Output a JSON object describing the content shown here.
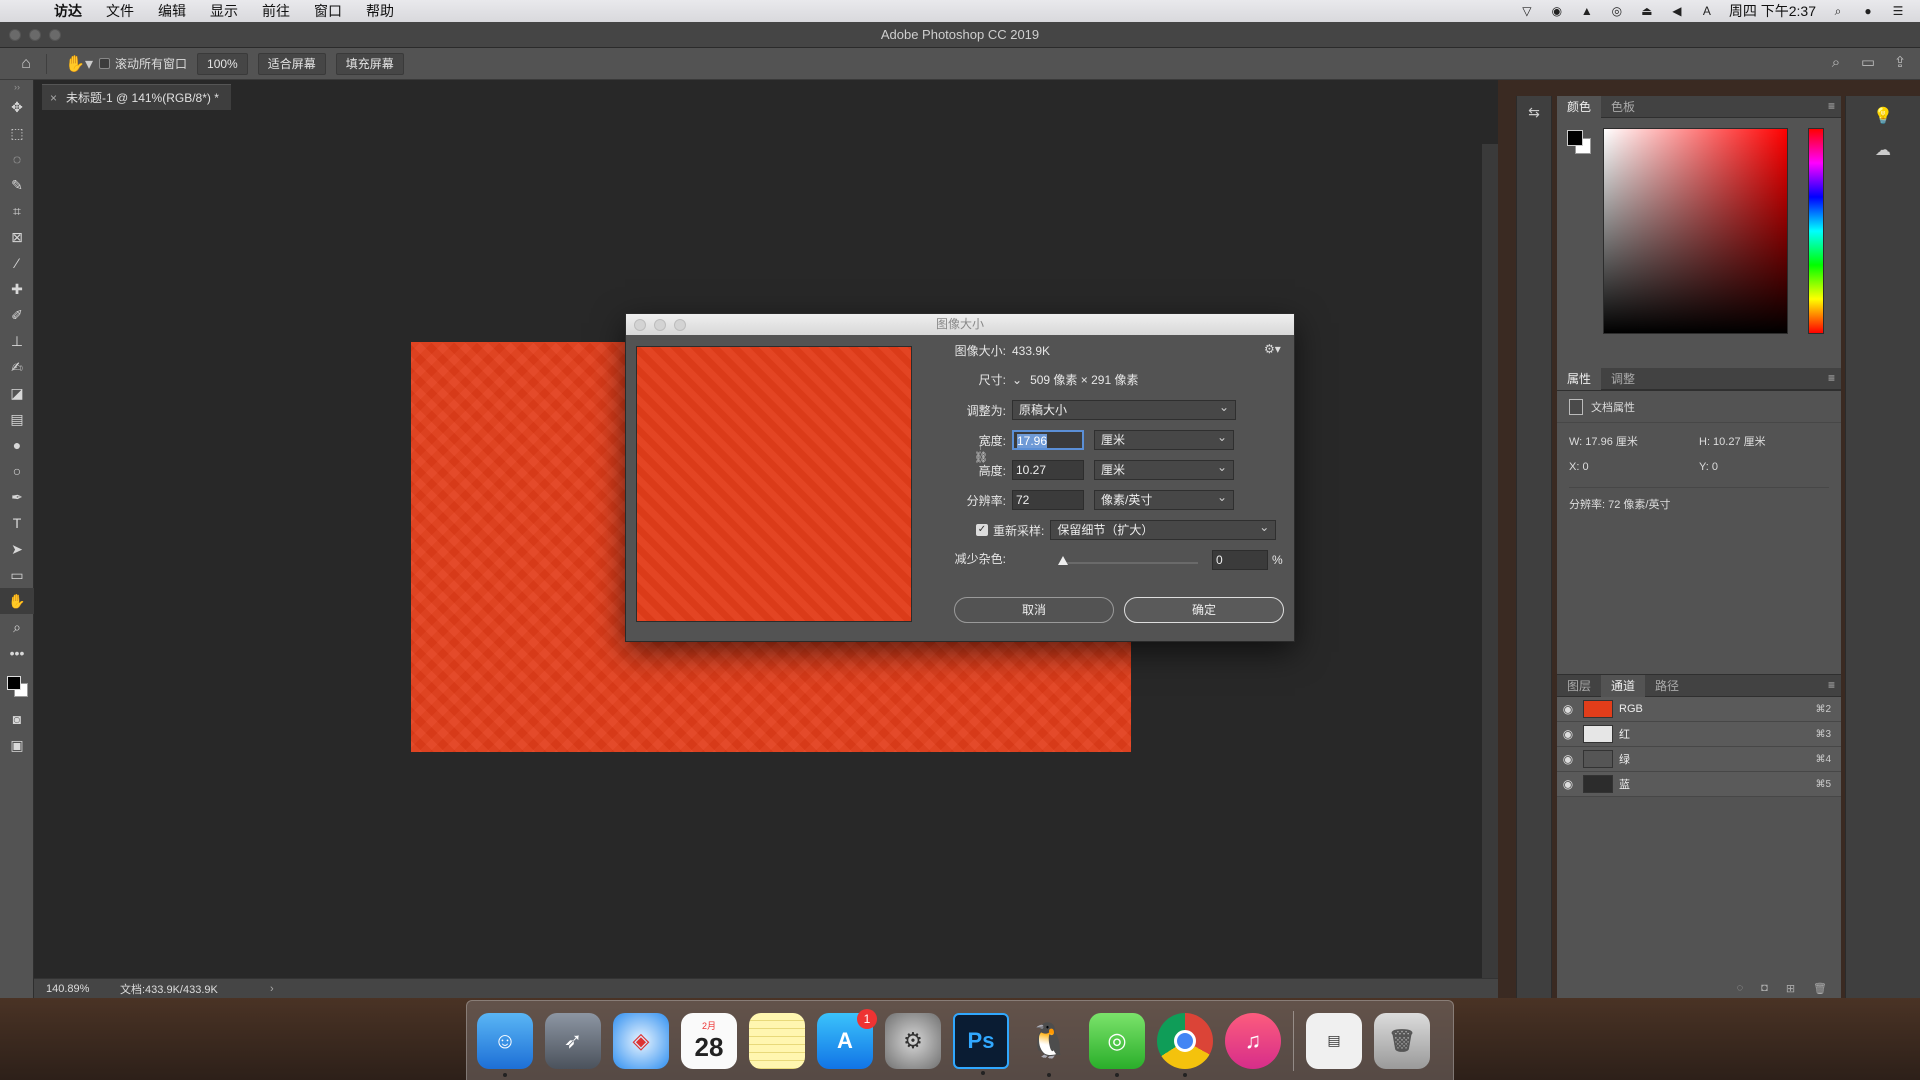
{
  "menubar": {
    "apple": "",
    "items": [
      "访达",
      "文件",
      "编辑",
      "显示",
      "前往",
      "窗口",
      "帮助"
    ],
    "status_icons": [
      "vector-icon",
      "wechat-icon",
      "bell-icon",
      "nvidia-icon",
      "eject-icon",
      "volume-icon",
      "input-method-icon"
    ],
    "input_method": "A",
    "clock": "周四 下午2:37"
  },
  "titlebar": {
    "title": "Adobe Photoshop CC 2019"
  },
  "optionsbar": {
    "scroll_all_label": "滚动所有窗口",
    "zoom_100": "100%",
    "fit_screen": "适合屏幕",
    "fill_screen": "填充屏幕"
  },
  "document": {
    "tab_label": "未标题-1 @ 141%(RGB/8*) *",
    "status_zoom": "140.89%",
    "status_doc": "文档:433.9K/433.9K",
    "canvas_color": "#e23d1a"
  },
  "panels": {
    "color_tabs": [
      "颜色",
      "色板"
    ],
    "props_tabs": [
      "属性",
      "调整"
    ],
    "doc_props_label": "文档属性",
    "w": "W: 17.96 厘米",
    "h": "H: 10.27 厘米",
    "x": "X: 0",
    "y": "Y: 0",
    "resolution": "分辨率: 72 像素/英寸",
    "layer_tabs": [
      "图层",
      "通道",
      "路径"
    ],
    "channels": [
      {
        "name": "RGB",
        "shortcut": "⌘2",
        "thumb": "#e23d1a"
      },
      {
        "name": "红",
        "shortcut": "⌘3",
        "thumb": "#e6e6e6"
      },
      {
        "name": "绿",
        "shortcut": "⌘4",
        "thumb": "#555555"
      },
      {
        "name": "蓝",
        "shortcut": "⌘5",
        "thumb": "#2c2c2c"
      }
    ]
  },
  "dialog": {
    "title": "图像大小",
    "image_size_label": "图像大小:",
    "image_size_value": "433.9K",
    "dimensions_label": "尺寸:",
    "dimensions_value": "509 像素  ×  291 像素",
    "fit_label": "调整为:",
    "fit_value": "原稿大小",
    "width_label": "宽度:",
    "width_value": "17.96",
    "width_unit": "厘米",
    "height_label": "高度:",
    "height_value": "10.27",
    "height_unit": "厘米",
    "resolution_label": "分辨率:",
    "resolution_value": "72",
    "resolution_unit": "像素/英寸",
    "resample_label": "重新采样:",
    "resample_value": "保留细节（扩大）",
    "noise_label": "减少杂色:",
    "noise_value": "0",
    "noise_unit": "%",
    "cancel": "取消",
    "ok": "确定"
  },
  "dock": {
    "calendar_month": "2月",
    "calendar_day": "28",
    "appstore_badge": "1",
    "ps_label": "Ps"
  }
}
